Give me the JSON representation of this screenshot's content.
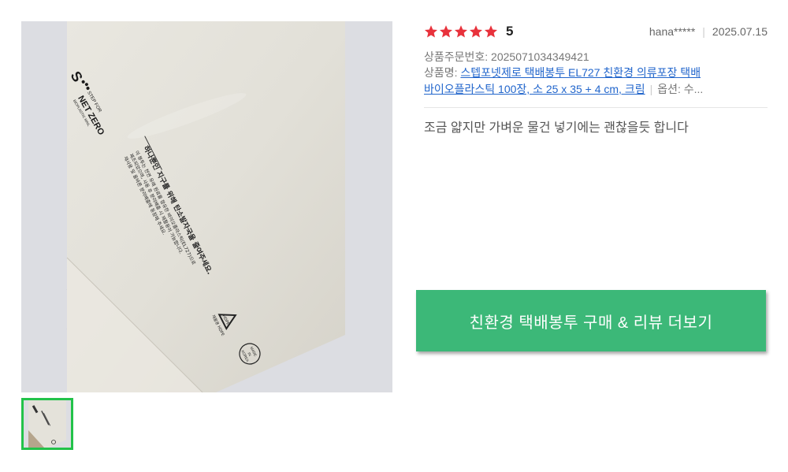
{
  "review": {
    "rating": "5",
    "rating_stars": 5,
    "user": "hana*****",
    "date": "2025.07.15",
    "order_number": "상품주문번호: 2025071034349421",
    "product_prefix": "상품명: ",
    "product_name_line1": "스텝포넷제로 택배봉투 EL727 친환경 의류포장 택배",
    "product_name_line2": "바이오플라스틱 100장, 소 25 x 35 + 4 cm, 크림",
    "option": "옵션: 수...",
    "text": "조금 얇지만 가벼운 물건 넣기에는 괜찮을듯 합니다"
  },
  "photo": {
    "brand_top": "STEP FOR",
    "brand_main": "NET ZERO",
    "brand_sub": "BIOPLASTIC MAIL",
    "headline": "하나뿐인 지구를 위해 탄소발자국을 줄여주세요.",
    "body1": "이 봉투는 천연 유래 원료를 함유한 바이오플라스틱(EL727)으로",
    "body2": "제조되었으며, 사용 후 분리배출 시 재활용이 가능합니다.",
    "body3": "재사용 및 올바른 분리배출에 동참해 주세요.",
    "recycle_label": "재활용 HDPE",
    "circle_label1": "MADE",
    "circle_label2": "IN",
    "circle_label3": "KOREA"
  },
  "cta": {
    "label": "친환경 택배봉투 구매 & 리뷰 더보기",
    "color": "#3cb878"
  },
  "colors": {
    "star": "#e8323c",
    "link": "#2266cc",
    "thumb_border": "#22c24a"
  }
}
